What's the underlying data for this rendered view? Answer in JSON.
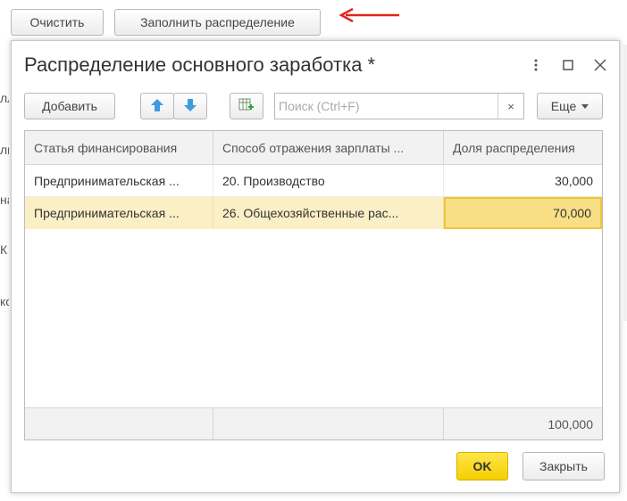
{
  "background": {
    "buttons": {
      "clear": "Очистить",
      "fill": "Заполнить распределение"
    },
    "fragments": [
      "лл",
      "ль",
      "на",
      "К",
      "ко"
    ]
  },
  "dialog": {
    "title": "Распределение основного заработка *",
    "toolbar": {
      "add": "Добавить",
      "search_placeholder": "Поиск (Ctrl+F)",
      "search_value": "",
      "clear": "×",
      "more": "Еще",
      "icons": [
        "arrow-up-icon",
        "arrow-down-icon",
        "table-add-icon",
        "chevron-down-icon"
      ]
    },
    "title_icons": [
      "more-vertical-icon",
      "maximize-icon",
      "close-icon"
    ],
    "table": {
      "headers": [
        "Статья финансирования",
        "Способ отражения зарплаты ...",
        "Доля распределения"
      ],
      "rows": [
        [
          "Предпринимательская ...",
          "20. Производство",
          "30,000"
        ],
        [
          "Предпринимательская ...",
          "26. Общехозяйственные рас...",
          "70,000"
        ]
      ],
      "total": "100,000"
    },
    "buttons": {
      "ok": "OK",
      "close": "Закрыть"
    }
  },
  "colors": {
    "accent_yellow": "#f5cf00",
    "selected_row": "#fbefc6",
    "selected_cell": "#f8df86",
    "arrow_red": "#e0261b",
    "up_down_blue": "#3f9ae0"
  }
}
